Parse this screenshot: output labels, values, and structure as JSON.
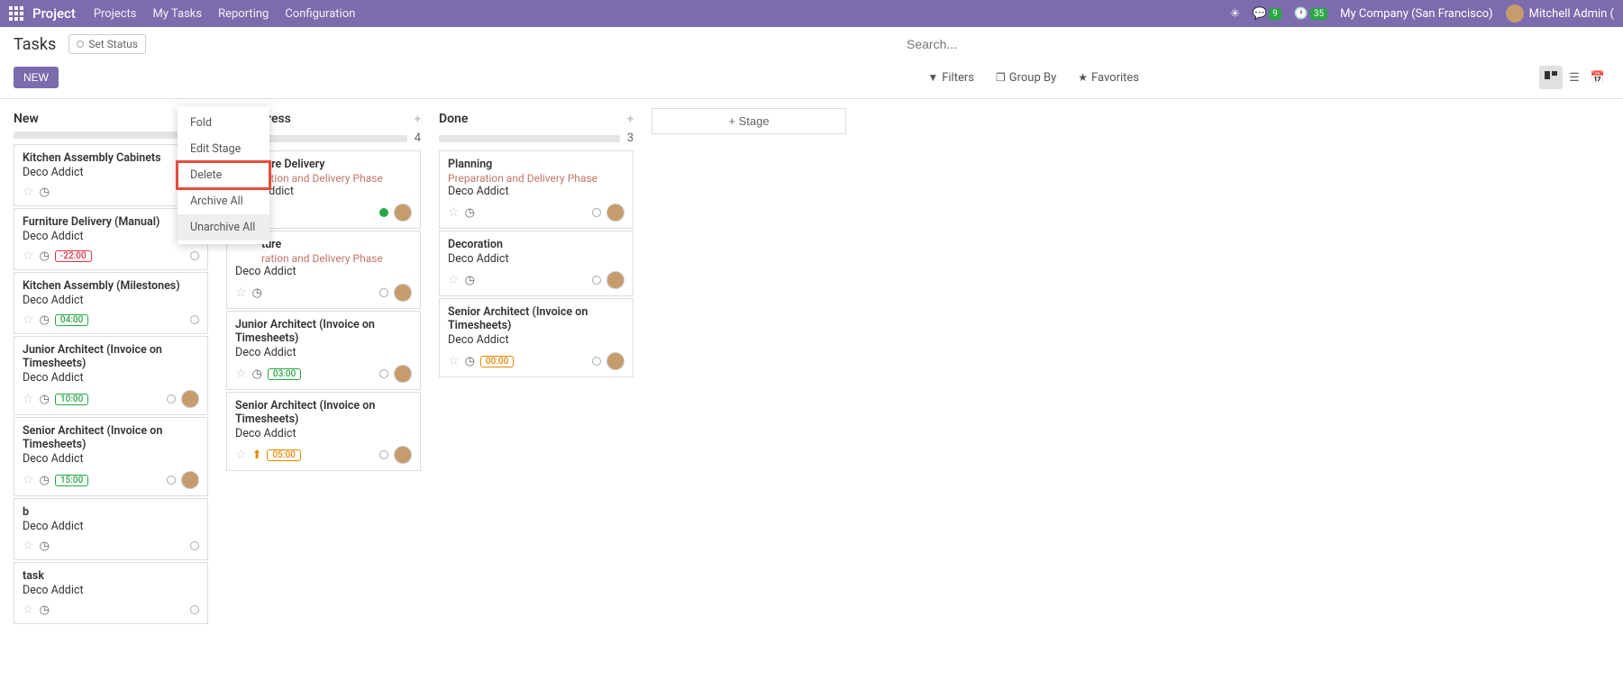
{
  "topbar": {
    "brand": "Project",
    "nav": [
      "Projects",
      "My Tasks",
      "Reporting",
      "Configuration"
    ],
    "chat_badge": "9",
    "activity_badge": "35",
    "company": "My Company (San Francisco)",
    "user": "Mitchell Admin ("
  },
  "toolbar1": {
    "breadcrumb": "Tasks",
    "status_btn": "Set Status",
    "search_placeholder": "Search..."
  },
  "toolbar2": {
    "new": "NEW",
    "filters": "Filters",
    "group_by": "Group By",
    "favorites": "Favorites"
  },
  "context_menu": {
    "fold": "Fold",
    "edit_stage": "Edit Stage",
    "delete": "Delete",
    "archive_all": "Archive All",
    "unarchive_all": "Unarchive All"
  },
  "add_stage_label": "Stage",
  "columns": [
    {
      "title": "New",
      "count": "",
      "cards": [
        {
          "title": "Kitchen Assembly Cabinets",
          "customer": "Deco Addict"
        },
        {
          "title": "Furniture Delivery (Manual)",
          "customer": "Deco Addict",
          "time": "-22:00",
          "time_class": "red"
        },
        {
          "title": "Kitchen Assembly (Milestones)",
          "customer": "Deco Addict",
          "time": "04:00",
          "time_class": "green"
        },
        {
          "title": "Junior Architect (Invoice on Timesheets)",
          "customer": "Deco Addict",
          "time": "10:00",
          "time_class": "green",
          "avatar": true
        },
        {
          "title": "Senior Architect (Invoice on Timesheets)",
          "customer": "Deco Addict",
          "time": "15:00",
          "time_class": "green",
          "avatar": true
        },
        {
          "title": "b",
          "customer": "Deco Addict"
        },
        {
          "title": "task",
          "customer": "Deco Addict"
        }
      ]
    },
    {
      "title": "In Progress",
      "count": "4",
      "cards": [
        {
          "title_prefix": "ture Delivery",
          "phase_prefix": "ration and Delivery Phase",
          "customer_prefix": "Addict",
          "state": "green",
          "avatar": true
        },
        {
          "title_prefix": "ture",
          "phase_prefix": "ration and Delivery Phase",
          "customer": "Deco Addict",
          "avatar": true
        },
        {
          "title": "Junior Architect (Invoice on Timesheets)",
          "customer": "Deco Addict",
          "time": "03:00",
          "time_class": "green",
          "avatar": true
        },
        {
          "title": "Senior Architect (Invoice on Timesheets)",
          "customer": "Deco Addict",
          "time": "05:00",
          "time_class": "orange",
          "upload": true,
          "avatar": true
        }
      ]
    },
    {
      "title": "Done",
      "count": "3",
      "cards": [
        {
          "title": "Planning",
          "phase": "Preparation and Delivery Phase",
          "customer": "Deco Addict",
          "avatar": true
        },
        {
          "title": "Decoration",
          "customer": "Deco Addict",
          "avatar": true
        },
        {
          "title": "Senior Architect (Invoice on Timesheets)",
          "customer": "Deco Addict",
          "time": "00:00",
          "time_class": "orange",
          "avatar": true
        }
      ]
    }
  ]
}
